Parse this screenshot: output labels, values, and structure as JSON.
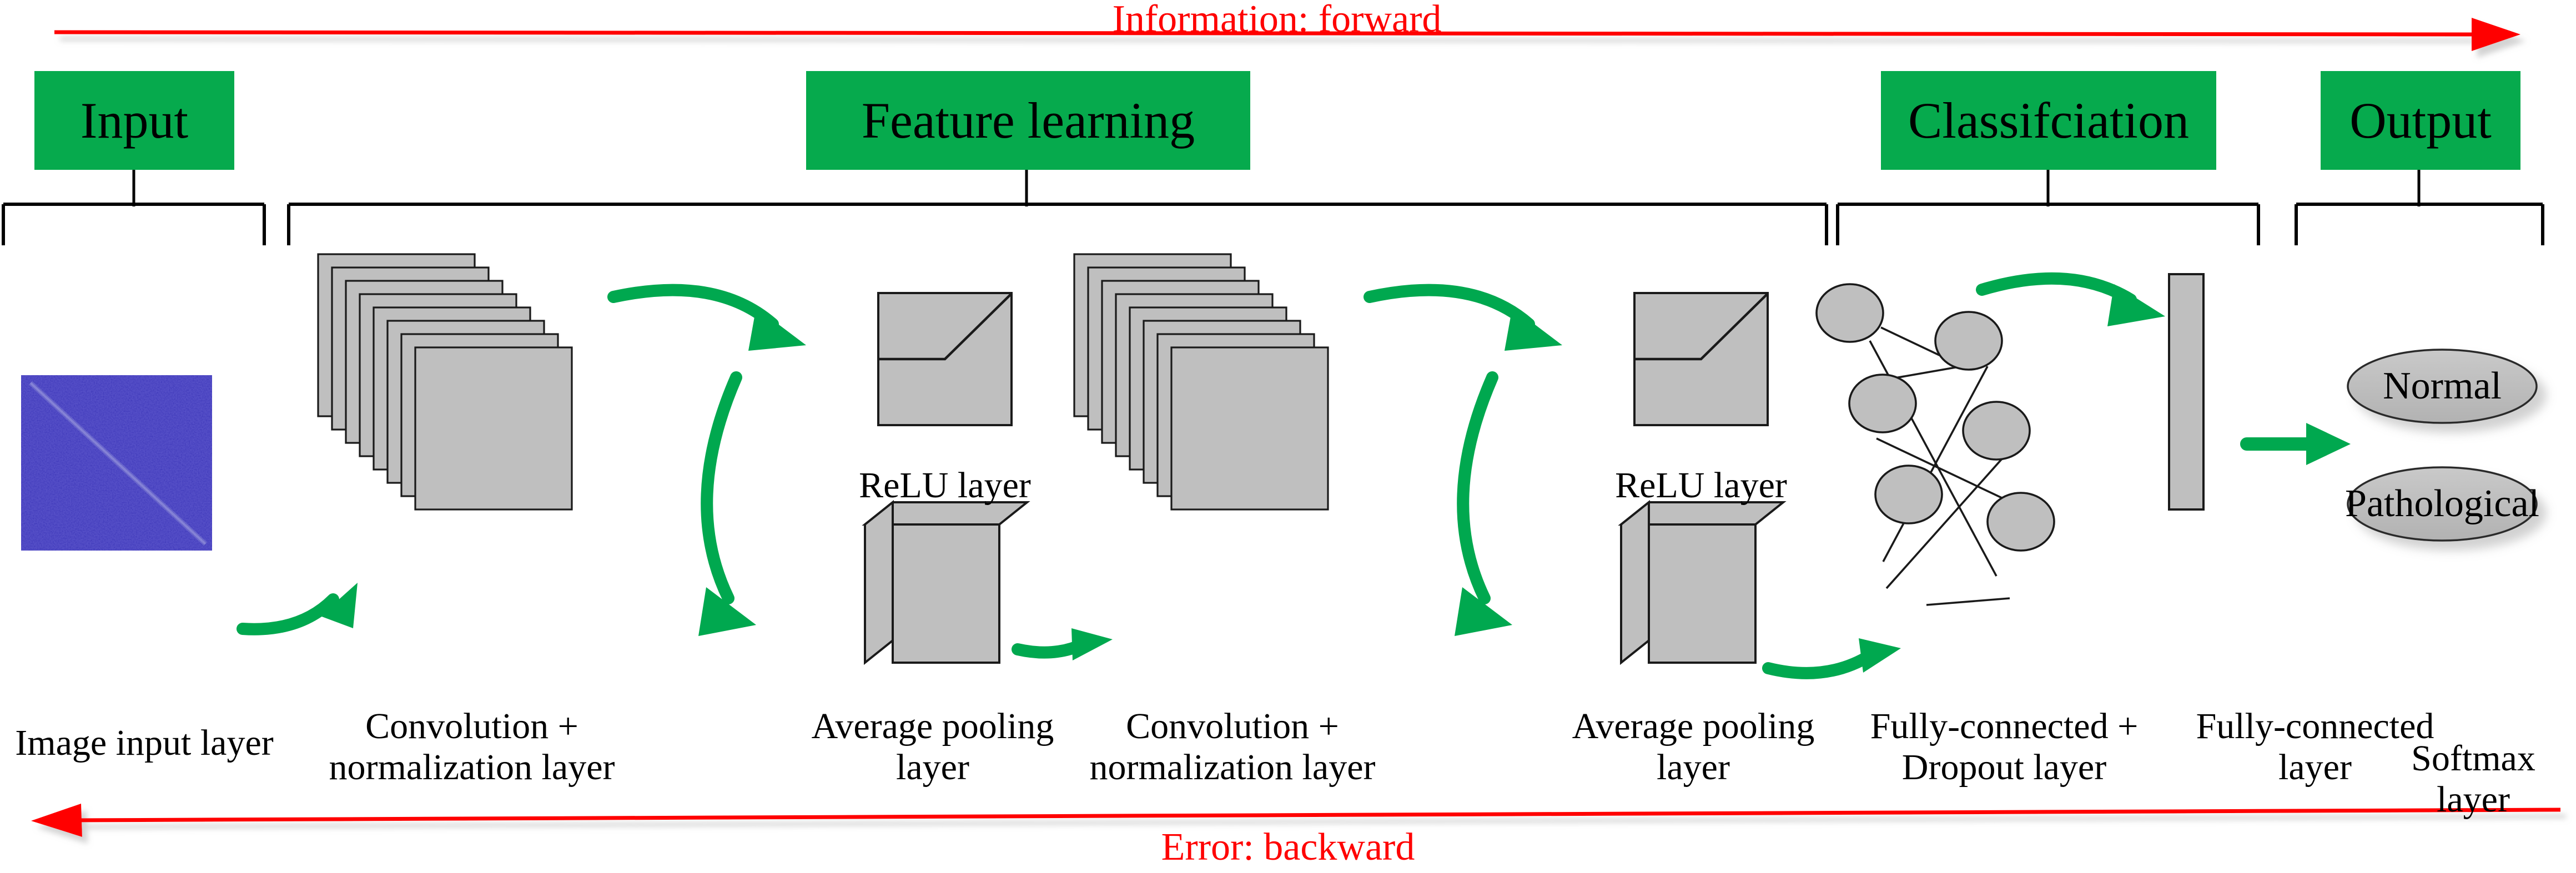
{
  "figure": {
    "title": "Convolutional neural network architecture for normal vs pathological classification",
    "colors": {
      "header_green": "#06AA4D",
      "arrow_green": "#00A84F",
      "red": "#FF0000",
      "shape_gray": "#BFBFBF",
      "shape_stroke": "#1A1A1A",
      "input_blue": "#2E28B0",
      "background": "#FFFFFF"
    }
  },
  "flow": {
    "forward_label": "Information: forward",
    "backward_label": "Error: backward"
  },
  "stages": [
    {
      "id": "input",
      "label": "Input"
    },
    {
      "id": "feature",
      "label": "Feature learning"
    },
    {
      "id": "classification",
      "label": "Classifciation"
    },
    {
      "id": "output",
      "label": "Output"
    }
  ],
  "layers": [
    {
      "id": "image-input",
      "label": "Image input layer"
    },
    {
      "id": "conv-norm-1",
      "label": "Convolution +\nnormalization layer"
    },
    {
      "id": "relu-1",
      "label": "ReLU layer"
    },
    {
      "id": "avgpool-1",
      "label": "Average pooling\nlayer"
    },
    {
      "id": "conv-norm-2",
      "label": "Convolution +\nnormalization layer"
    },
    {
      "id": "relu-2",
      "label": "ReLU layer"
    },
    {
      "id": "avgpool-2",
      "label": "Average pooling\nlayer"
    },
    {
      "id": "fc-dropout",
      "label": "Fully-connected +\nDropout layer"
    },
    {
      "id": "fc",
      "label": "Fully-connected\nlayer"
    },
    {
      "id": "softmax",
      "label": "Softmax layer"
    }
  ],
  "outputs": [
    {
      "id": "normal",
      "label": "Normal"
    },
    {
      "id": "pathological",
      "label": "Pathological"
    }
  ],
  "feature_map_stack": {
    "count": 8
  },
  "fully_connected_graph": {
    "node_count": 6
  }
}
